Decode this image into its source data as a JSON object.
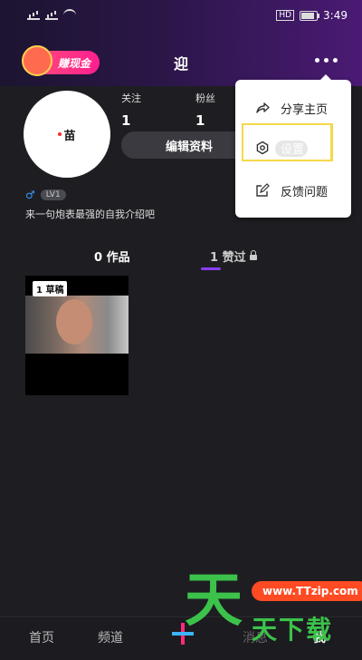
{
  "status_bar": {
    "time": "3:49",
    "hd_label": "HD"
  },
  "header": {
    "title": "迎",
    "earn_badge": "赚现金"
  },
  "profile": {
    "avatar_text": "苗",
    "following_label": "关注",
    "following_count": "1",
    "followers_label": "粉丝",
    "followers_count": "1",
    "edit_button": "编辑资料",
    "gender_symbol": "♂",
    "level": "LV1",
    "bio": "来一句炮表最强的自我介绍吧"
  },
  "tabs": {
    "works": "0 作品",
    "liked": "1 赞过"
  },
  "video": {
    "draft_label": "1 草稿"
  },
  "menu": {
    "share": "分享主页",
    "settings": "设置",
    "feedback": "反馈问题"
  },
  "tabbar": {
    "home": "首页",
    "channel": "频道",
    "message": "消息",
    "me": "我"
  },
  "watermark": {
    "big": "天",
    "url": "www.TTzip.com",
    "small": "天下载"
  },
  "colors": {
    "accent_purple": "#8a3cff",
    "highlight_yellow": "#f5d84a",
    "watermark_green": "#3cc24a"
  }
}
